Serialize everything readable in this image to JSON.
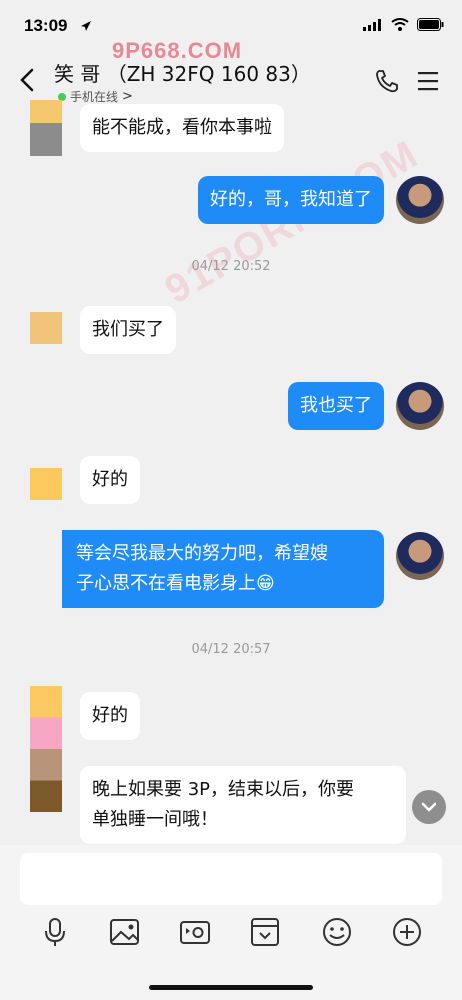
{
  "status": {
    "time": "13:09"
  },
  "watermark": {
    "text": "9P668.COM",
    "text2": "91PORN.COM"
  },
  "header": {
    "title": "笑 哥 （ZH 32FQ 160 83）",
    "subtitle": "手机在线",
    "subtitle_arrow": ">"
  },
  "messages": [
    {
      "side": "them",
      "text": "能不能成，看你本事啦"
    },
    {
      "side": "me",
      "text": "好的，哥，我知道了"
    },
    {
      "type": "time",
      "text": "04/12 20:52"
    },
    {
      "side": "them",
      "text": "我们买了"
    },
    {
      "side": "me",
      "text": "我也买了"
    },
    {
      "side": "them",
      "text": "好的"
    },
    {
      "side": "me",
      "line1": "等会尽我最大的努力吧，希望嫂",
      "line2": "子心思不在看电影身上😁"
    },
    {
      "type": "time",
      "text": "04/12 20:57"
    },
    {
      "side": "them",
      "text": "好的"
    },
    {
      "side": "them",
      "line1": "晚上如果要 3P，结束以后，你要",
      "line2": "单独睡一间哦！"
    }
  ],
  "input": {
    "placeholder": ""
  },
  "toolbar_icons": [
    "microphone-icon",
    "image-icon",
    "video-icon",
    "favorites-icon",
    "emoji-icon",
    "plus-icon"
  ],
  "colors": {
    "accent": "#1e8bf7",
    "online": "#3fce57",
    "background": "#f0f0f0"
  }
}
